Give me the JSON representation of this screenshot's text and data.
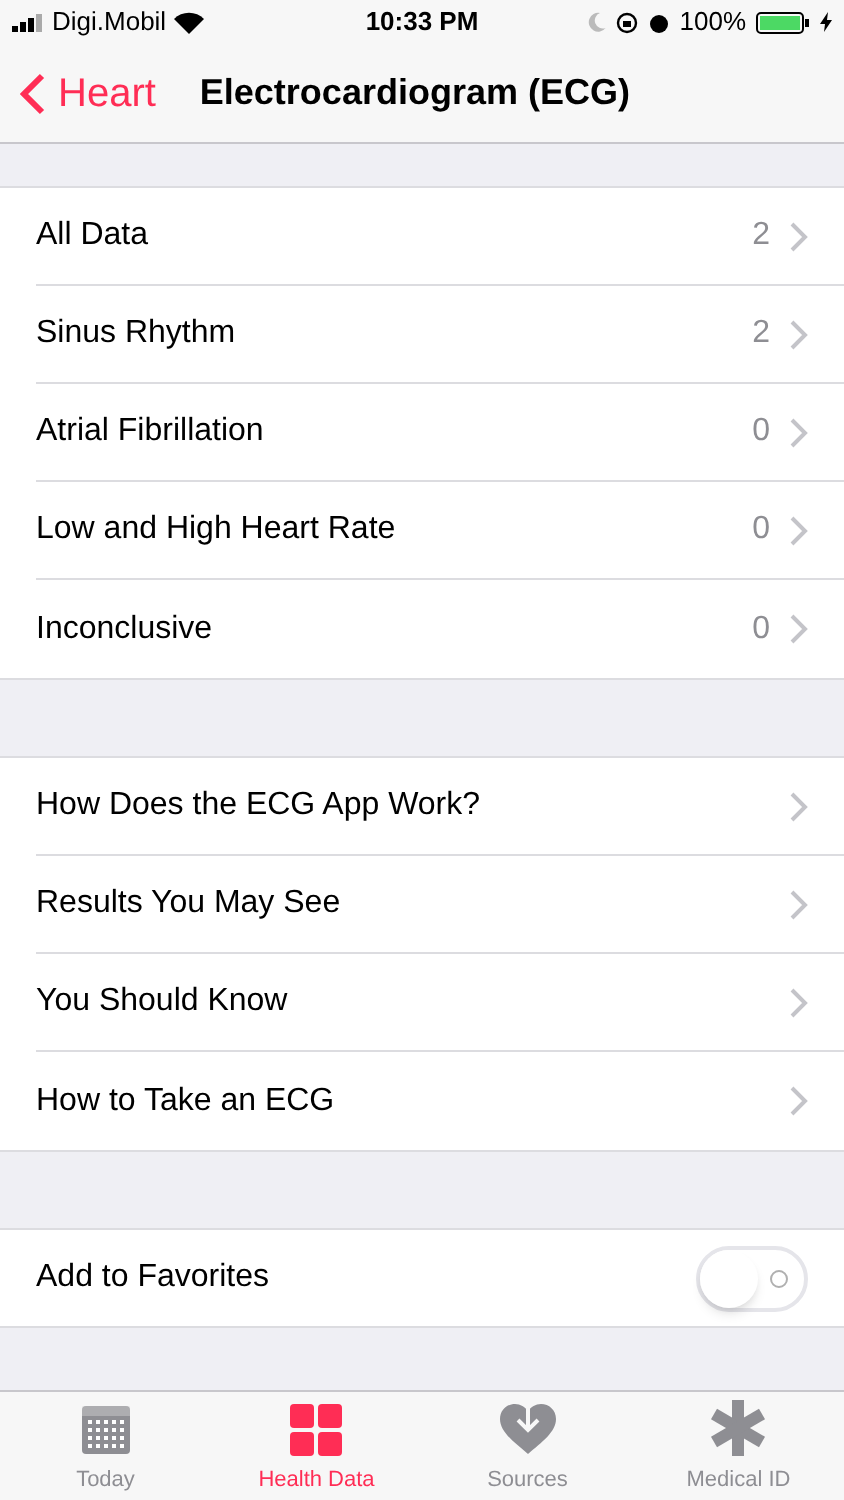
{
  "status_bar": {
    "carrier": "Digi.Mobil",
    "time": "10:33 PM",
    "battery": "100%"
  },
  "nav": {
    "back": "Heart",
    "title": "Electrocardiogram (ECG)"
  },
  "results": [
    {
      "label": "All Data",
      "count": "2"
    },
    {
      "label": "Sinus Rhythm",
      "count": "2"
    },
    {
      "label": "Atrial Fibrillation",
      "count": "0"
    },
    {
      "label": "Low and High Heart Rate",
      "count": "0"
    },
    {
      "label": "Inconclusive",
      "count": "0"
    }
  ],
  "info": [
    {
      "label": "How Does the ECG App Work?"
    },
    {
      "label": "Results You May See"
    },
    {
      "label": "You Should Know"
    },
    {
      "label": "How to Take an ECG"
    }
  ],
  "favorites": {
    "label": "Add to Favorites",
    "on": false
  },
  "tabs": [
    {
      "label": "Today",
      "kind": "calendar",
      "selected": false
    },
    {
      "label": "Health Data",
      "kind": "grid",
      "selected": true
    },
    {
      "label": "Sources",
      "kind": "sources",
      "selected": false
    },
    {
      "label": "Medical ID",
      "kind": "medical",
      "selected": false
    }
  ]
}
